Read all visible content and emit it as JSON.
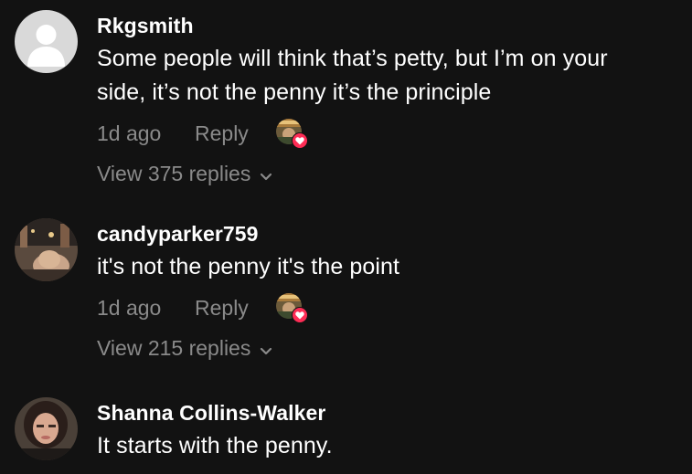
{
  "comments": [
    {
      "username": "Rkgsmith",
      "text_lines": [
        "Some people will think that’s petty, but I’m on your",
        "side, it’s not the penny it’s the principle"
      ],
      "time": "1d ago",
      "reply_label": "Reply",
      "view_replies": "View 375 replies",
      "avatar": "default-avatar"
    },
    {
      "username": "candyparker759",
      "text_lines": [
        "it's not the penny it's the point"
      ],
      "time": "1d ago",
      "reply_label": "Reply",
      "view_replies": "View 215 replies",
      "avatar": "photo-avatar"
    },
    {
      "username": "Shanna Collins-Walker",
      "text_lines": [
        "It starts with the penny."
      ],
      "avatar": "photo-avatar"
    }
  ],
  "colors": {
    "background": "#121212",
    "text": "#ffffff",
    "muted": "#8a8a8a",
    "like_badge": "#fe2c55"
  },
  "icons": {
    "creator_like": "heart-icon",
    "expand": "chevron-down-icon"
  }
}
